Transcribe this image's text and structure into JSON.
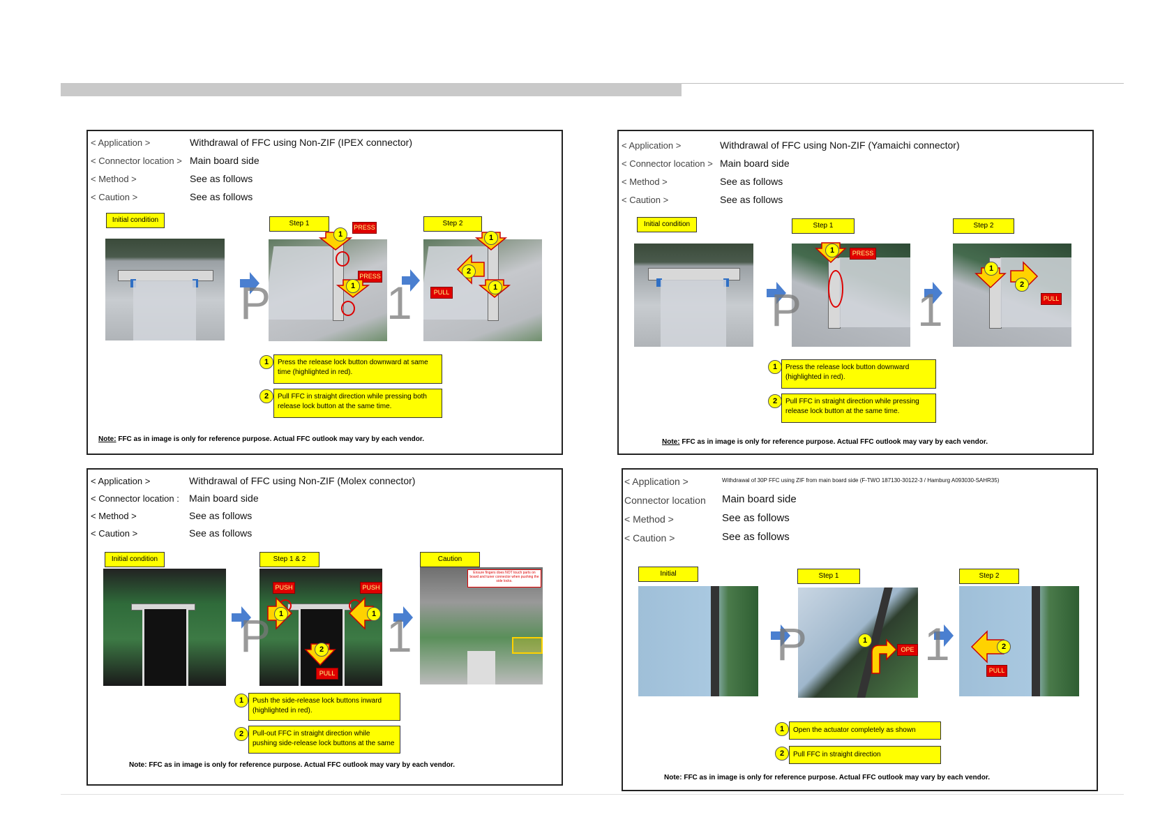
{
  "page": {
    "title": ""
  },
  "panels": [
    {
      "id": "ipex",
      "application_label": "< Application >",
      "application": "Withdrawal of FFC using Non-ZIF (IPEX connector)",
      "connector_label": "< Connector location >",
      "connector": "Main board side",
      "method_label": "< Method >",
      "method": "See as follows",
      "caution_label": "< Caution >",
      "caution": "See as follows",
      "labels": [
        "Initial condition",
        "Step 1",
        "Step 2"
      ],
      "tags": [
        "PRESS",
        "PRESS",
        "PULL"
      ],
      "steps": [
        "Press the release lock button downward at same time (highlighted in red).",
        "Pull FFC in straight direction while pressing both release lock button at the same time."
      ],
      "note_prefix": "Note:",
      "note": " FFC as in image is only for reference purpose. Actual FFC outlook may vary by each vendor."
    },
    {
      "id": "yamaichi",
      "application_label": "< Application >",
      "application": "Withdrawal of FFC using Non-ZIF (Yamaichi connector)",
      "connector_label": "< Connector location >",
      "connector": "Main board side",
      "method_label": "< Method >",
      "method": "See as follows",
      "caution_label": "< Caution >",
      "caution": "See as follows",
      "labels": [
        "Initial condition",
        "Step 1",
        "Step 2"
      ],
      "tags": [
        "PRESS",
        "PULL"
      ],
      "steps": [
        "Press the release lock button downward (highlighted in red).",
        "Pull FFC in straight direction while pressing release lock button at the same time."
      ],
      "note_prefix": "Note:",
      "note": " FFC as in image is only for reference purpose. Actual FFC outlook may vary by each vendor."
    },
    {
      "id": "molex",
      "application_label": "< Application >",
      "application": "Withdrawal of FFC using Non-ZIF (Molex connector)",
      "connector_label": "< Connector location :",
      "connector": "Main board side",
      "method_label": "< Method >",
      "method": "See as follows",
      "caution_label": "< Caution >",
      "caution": "See as follows",
      "labels": [
        "Initial condition",
        "Step 1 & 2",
        "Caution"
      ],
      "tags": [
        "PUSH",
        "PUSH",
        "PULL"
      ],
      "caution_note": "Ensure fingers does NOT touch parts on board and tuner connector when pushing the side locks.",
      "steps": [
        "Push the side-release lock buttons inward (highlighted in red).",
        "Pull-out FFC in straight direction while pushing side-release lock buttons at the same"
      ],
      "note": "Note: FFC as in image is only for reference purpose. Actual FFC outlook may vary by each vendor."
    },
    {
      "id": "zif",
      "application_label": "< Application >",
      "application": "Withdrawal of 30P FFC using ZIF from main board side (F-TWO 187130-30122-3 / Hamburg A093030-SAHR35)",
      "connector_label": "Connector location",
      "connector": "Main board side",
      "method_label": "< Method >",
      "method": "See as follows",
      "caution_label": "< Caution >",
      "caution": "See as follows",
      "labels": [
        "Initial",
        "Step 1",
        "Step 2"
      ],
      "tags": [
        "OPE",
        "PULL"
      ],
      "steps": [
        "Open the actuator completely as shown",
        "Pull FFC in straight direction"
      ],
      "note": "Note: FFC as in image is only for reference purpose. Actual FFC outlook may vary by each vendor."
    }
  ],
  "markers": {
    "one": "1",
    "two": "2"
  },
  "watermark": "P",
  "watermark2": "1"
}
